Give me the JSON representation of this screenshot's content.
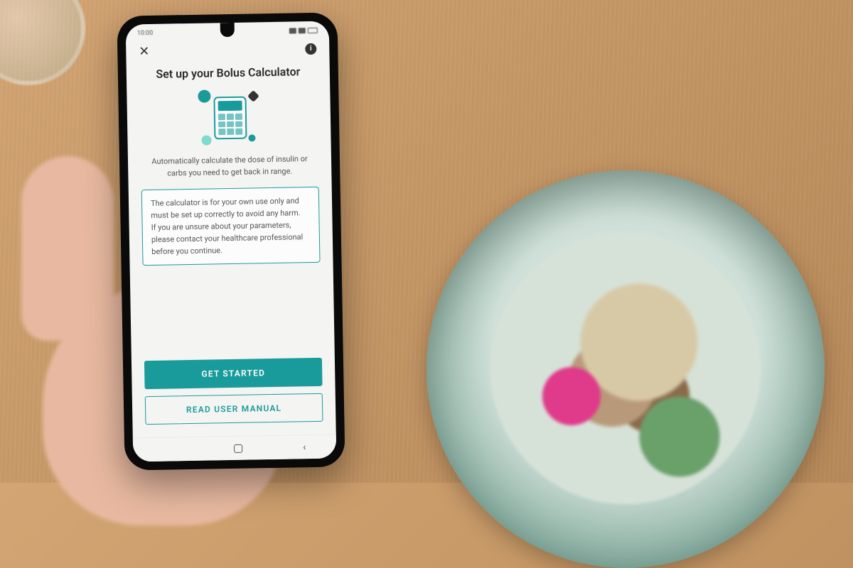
{
  "statusbar": {
    "time": "10:00"
  },
  "screen": {
    "title": "Set up your Bolus Calculator",
    "description": "Automatically calculate the dose of insulin or carbs you need to get back in range.",
    "warning_line1": "The calculator is for your own use only and must be set up correctly to avoid any harm.",
    "warning_line2": "If you are unsure about your parameters, please contact your healthcare professional before you continue.",
    "primary_button": "GET STARTED",
    "secondary_button": "READ USER MANUAL"
  },
  "icons": {
    "close": "✕",
    "info": "i",
    "back": "‹"
  }
}
